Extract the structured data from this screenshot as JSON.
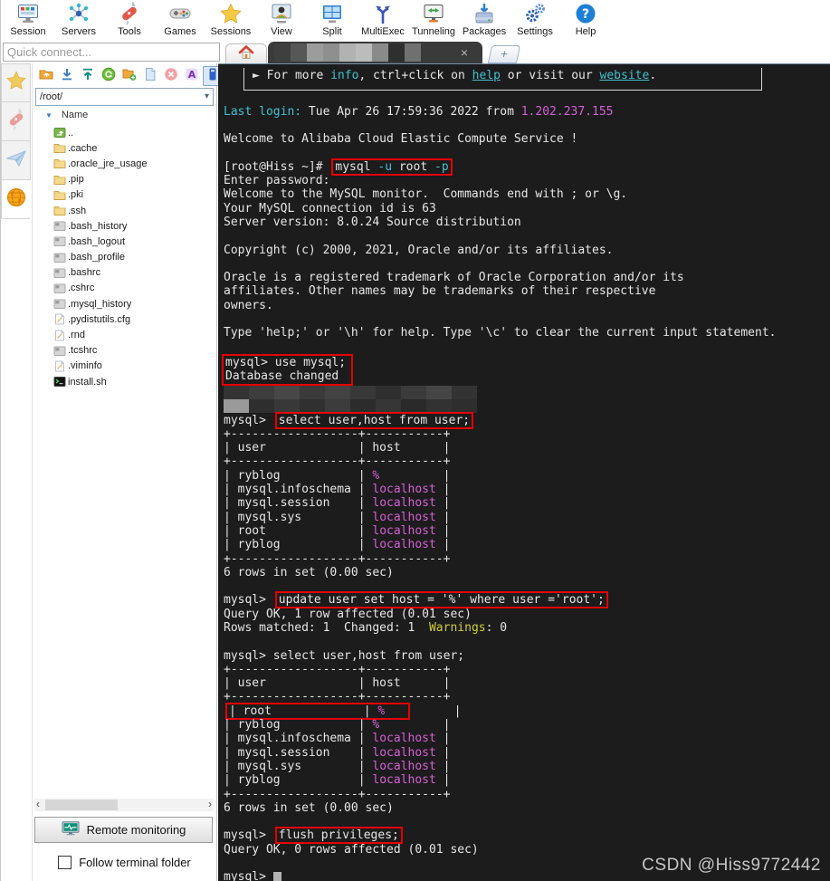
{
  "toolbar": {
    "items": [
      {
        "id": "session",
        "label": "Session",
        "icon": "session-icon"
      },
      {
        "id": "servers",
        "label": "Servers",
        "icon": "servers-icon"
      },
      {
        "id": "tools",
        "label": "Tools",
        "icon": "tools-icon"
      },
      {
        "id": "games",
        "label": "Games",
        "icon": "games-icon"
      },
      {
        "id": "sessions",
        "label": "Sessions",
        "icon": "star-icon"
      },
      {
        "id": "view",
        "label": "View",
        "icon": "view-icon"
      },
      {
        "id": "split",
        "label": "Split",
        "icon": "split-icon"
      },
      {
        "id": "multiexec",
        "label": "MultiExec",
        "icon": "multiexec-icon"
      },
      {
        "id": "tunneling",
        "label": "Tunneling",
        "icon": "tunneling-icon"
      },
      {
        "id": "packages",
        "label": "Packages",
        "icon": "packages-icon"
      },
      {
        "id": "settings",
        "label": "Settings",
        "icon": "settings-icon"
      },
      {
        "id": "help",
        "label": "Help",
        "icon": "help-icon"
      }
    ]
  },
  "quick_connect": {
    "placeholder": "Quick connect..."
  },
  "tabs": {
    "close_glyph": "×",
    "new_glyph": "+",
    "censor_blocks": [
      "#3f3f3f",
      "#575757",
      "#9c9c9c",
      "#8f8f8f",
      "#b2b2b2",
      "#bcbcbc",
      "#8a8a8a",
      "#2f2f2f",
      "#707070"
    ]
  },
  "sidebar": {
    "tabs": [
      {
        "id": "sessions",
        "icon": "strip-star-icon"
      },
      {
        "id": "tools",
        "icon": "strip-knife-icon"
      },
      {
        "id": "macros",
        "icon": "paper-plane-icon"
      },
      {
        "id": "sftp",
        "icon": "globe-icon",
        "active": true
      }
    ],
    "file_toolbar": [
      {
        "id": "parent-dir",
        "icon": "parent-dir-icon"
      },
      {
        "id": "download",
        "icon": "download-icon"
      },
      {
        "id": "upload",
        "icon": "upload-icon"
      },
      {
        "id": "refresh",
        "icon": "refresh-icon"
      },
      {
        "id": "new-folder",
        "icon": "new-folder-icon"
      },
      {
        "id": "new-file",
        "icon": "new-file-icon"
      },
      {
        "id": "delete",
        "icon": "delete-icon"
      },
      {
        "id": "rename",
        "icon": "rename-icon"
      },
      {
        "id": "disconnect",
        "icon": "exit-icon",
        "selected": true
      }
    ],
    "path": "/root/",
    "name_header": "Name",
    "sort_glyph": "▼",
    "chevron_glyph": "▾",
    "scroll_left_glyph": "‹",
    "scroll_right_glyph": "›",
    "files": [
      {
        "name": "..",
        "type": "up"
      },
      {
        "name": ".cache",
        "type": "folder"
      },
      {
        "name": ".oracle_jre_usage",
        "type": "folder"
      },
      {
        "name": ".pip",
        "type": "folder"
      },
      {
        "name": ".pki",
        "type": "folder"
      },
      {
        "name": ".ssh",
        "type": "folder"
      },
      {
        "name": ".bash_history",
        "type": "grayfile"
      },
      {
        "name": ".bash_logout",
        "type": "grayfile"
      },
      {
        "name": ".bash_profile",
        "type": "grayfile"
      },
      {
        "name": ".bashrc",
        "type": "grayfile"
      },
      {
        "name": ".cshrc",
        "type": "grayfile"
      },
      {
        "name": ".mysql_history",
        "type": "grayfile"
      },
      {
        "name": ".pydistutils.cfg",
        "type": "textfile"
      },
      {
        "name": ".rnd",
        "type": "textfile"
      },
      {
        "name": ".tcshrc",
        "type": "grayfile"
      },
      {
        "name": ".viminfo",
        "type": "textfile"
      },
      {
        "name": "install.sh",
        "type": "script"
      }
    ],
    "remote_monitoring_label": "Remote monitoring",
    "follow_terminal_label": "Follow terminal folder"
  },
  "terminal": {
    "watermark": "CSDN @Hiss9772442",
    "censor_rows": [
      [
        "#343434",
        "#3d3d3d",
        "#474747",
        "#3a3a3a",
        "#424242",
        "#383838",
        "#2f2f2f",
        "#3b3b3b",
        "#454545",
        "#333333"
      ],
      [
        "#9a9a9a",
        "#2e2e2e",
        "#383838",
        "#303030",
        "#3c3c3c",
        "#2c2c2c",
        "#363636",
        "#2a2a2a",
        "#323232",
        "#2e2e2e"
      ]
    ],
    "lines": [
      {
        "banner": true,
        "s": [
          [
            "► For more ",
            ""
          ],
          [
            "info",
            "c"
          ],
          [
            ", ctrl+click on ",
            ""
          ],
          [
            "help",
            "u"
          ],
          [
            " or visit our ",
            ""
          ],
          [
            "website",
            "u"
          ],
          [
            ".",
            ""
          ]
        ]
      },
      {
        "s": []
      },
      {
        "s": [
          [
            "Last login:",
            "c"
          ],
          [
            " Tue Apr 26 17:59:36 2022 from ",
            ""
          ],
          [
            "1.202.237.155",
            "m"
          ]
        ]
      },
      {
        "s": []
      },
      {
        "s": [
          [
            "Welcome to Alibaba Cloud Elastic Compute Service !",
            ""
          ]
        ]
      },
      {
        "s": []
      },
      {
        "s": [
          [
            "[root@Hiss ~]# ",
            ""
          ],
          {
            "box": [
              [
                "mysql",
                ""
              ],
              [
                " -u",
                "c"
              ],
              [
                " root",
                ""
              ],
              [
                " -p",
                "c"
              ]
            ]
          }
        ]
      },
      {
        "s": [
          [
            "Enter password:",
            ""
          ]
        ]
      },
      {
        "s": [
          [
            "Welcome to the MySQL monitor.  Commands end with ; or \\g.",
            ""
          ]
        ]
      },
      {
        "s": [
          [
            "Your MySQL connection id is 63",
            ""
          ]
        ]
      },
      {
        "s": [
          [
            "Server version: 8.0.24 Source distribution",
            ""
          ]
        ]
      },
      {
        "s": []
      },
      {
        "s": [
          [
            "Copyright (c) 2000, 2021, Oracle and/or its affiliates.",
            ""
          ]
        ]
      },
      {
        "s": []
      },
      {
        "s": [
          [
            "Oracle is a registered trademark of Oracle Corporation and/or its",
            ""
          ]
        ]
      },
      {
        "s": [
          [
            "affiliates. Other names may be trademarks of their respective",
            ""
          ]
        ]
      },
      {
        "s": [
          [
            "owners.",
            ""
          ]
        ]
      },
      {
        "s": []
      },
      {
        "s": [
          [
            "Type 'help;' or '\\h' for help. Type '\\c' to clear the current input statement.",
            ""
          ]
        ]
      },
      {
        "s": []
      },
      {
        "s": [
          [
            "mysql> use mysql;",
            ""
          ]
        ],
        "g": 1
      },
      {
        "s": [
          [
            "Database changed",
            ""
          ]
        ],
        "g": 1
      },
      {
        "censor": true
      },
      {
        "s": [
          [
            "mysql> ",
            ""
          ],
          {
            "box": [
              [
                "select user,host from user;",
                ""
              ]
            ]
          }
        ]
      },
      {
        "s": [
          [
            "+------------------+-----------+",
            ""
          ]
        ]
      },
      {
        "s": [
          [
            "| user             | host      |",
            ""
          ]
        ]
      },
      {
        "s": [
          [
            "+------------------+-----------+",
            ""
          ]
        ]
      },
      {
        "s": [
          [
            "| ryblog           | ",
            ""
          ],
          [
            "%",
            "m"
          ],
          [
            "         |",
            ""
          ]
        ]
      },
      {
        "s": [
          [
            "| mysql.infoschema | ",
            ""
          ],
          [
            "localhost",
            "m"
          ],
          [
            " |",
            ""
          ]
        ]
      },
      {
        "s": [
          [
            "| mysql.session    | ",
            ""
          ],
          [
            "localhost",
            "m"
          ],
          [
            " |",
            ""
          ]
        ]
      },
      {
        "s": [
          [
            "| mysql.sys        | ",
            ""
          ],
          [
            "localhost",
            "m"
          ],
          [
            " |",
            ""
          ]
        ]
      },
      {
        "s": [
          [
            "| root             | ",
            ""
          ],
          [
            "localhost",
            "m"
          ],
          [
            " |",
            ""
          ]
        ]
      },
      {
        "s": [
          [
            "| ryblog           | ",
            ""
          ],
          [
            "localhost",
            "m"
          ],
          [
            " |",
            ""
          ]
        ]
      },
      {
        "s": [
          [
            "+------------------+-----------+",
            ""
          ]
        ]
      },
      {
        "s": [
          [
            "6 rows in set (0.00 sec)",
            ""
          ]
        ]
      },
      {
        "s": []
      },
      {
        "s": [
          [
            "mysql> ",
            ""
          ],
          {
            "box": [
              [
                "update user set host = '%' where user ='root';",
                ""
              ]
            ]
          }
        ]
      },
      {
        "s": [
          [
            "Query OK, 1 row affected (0.01 sec)",
            ""
          ]
        ]
      },
      {
        "s": [
          [
            "Rows matched: 1  Changed: 1  ",
            ""
          ],
          [
            "Warnings",
            "y"
          ],
          [
            ": 0",
            ""
          ]
        ]
      },
      {
        "s": []
      },
      {
        "s": [
          [
            "mysql> select user,host from user;",
            ""
          ]
        ]
      },
      {
        "s": [
          [
            "+------------------+-----------+",
            ""
          ]
        ]
      },
      {
        "s": [
          [
            "| user             | host      |",
            ""
          ]
        ]
      },
      {
        "s": [
          [
            "+------------------+-----------+",
            ""
          ]
        ]
      },
      {
        "s": [
          {
            "box": [
              [
                "| root             | ",
                ""
              ],
              [
                "%",
                "m"
              ],
              [
                "   ",
                ""
              ]
            ]
          },
          [
            "      |",
            ""
          ]
        ]
      },
      {
        "s": [
          [
            "| ryblog           | ",
            ""
          ],
          [
            "%",
            "m"
          ],
          [
            "         |",
            ""
          ]
        ]
      },
      {
        "s": [
          [
            "| mysql.infoschema | ",
            ""
          ],
          [
            "localhost",
            "m"
          ],
          [
            " |",
            ""
          ]
        ]
      },
      {
        "s": [
          [
            "| mysql.session    | ",
            ""
          ],
          [
            "localhost",
            "m"
          ],
          [
            " |",
            ""
          ]
        ]
      },
      {
        "s": [
          [
            "| mysql.sys        | ",
            ""
          ],
          [
            "localhost",
            "m"
          ],
          [
            " |",
            ""
          ]
        ]
      },
      {
        "s": [
          [
            "| ryblog           | ",
            ""
          ],
          [
            "localhost",
            "m"
          ],
          [
            " |",
            ""
          ]
        ]
      },
      {
        "s": [
          [
            "+------------------+-----------+",
            ""
          ]
        ]
      },
      {
        "s": [
          [
            "6 rows in set (0.00 sec)",
            ""
          ]
        ]
      },
      {
        "s": []
      },
      {
        "s": [
          [
            "mysql> ",
            ""
          ],
          {
            "box": [
              [
                "flush privileges;",
                ""
              ]
            ]
          }
        ]
      },
      {
        "s": [
          [
            "Query OK, 0 rows affected (0.01 sec)",
            ""
          ]
        ]
      },
      {
        "s": []
      },
      {
        "s": [
          [
            "mysql> ",
            ""
          ],
          [
            " ",
            "cur"
          ]
        ]
      }
    ]
  },
  "colors": {
    "terminal_bg": "#1c1c1c",
    "cyan": "#3fc1d1",
    "magenta": "#d75fd7",
    "yellow": "#cfcf3a",
    "annotation_red": "#e60000",
    "watermark_gray": "#c6c6c6"
  }
}
